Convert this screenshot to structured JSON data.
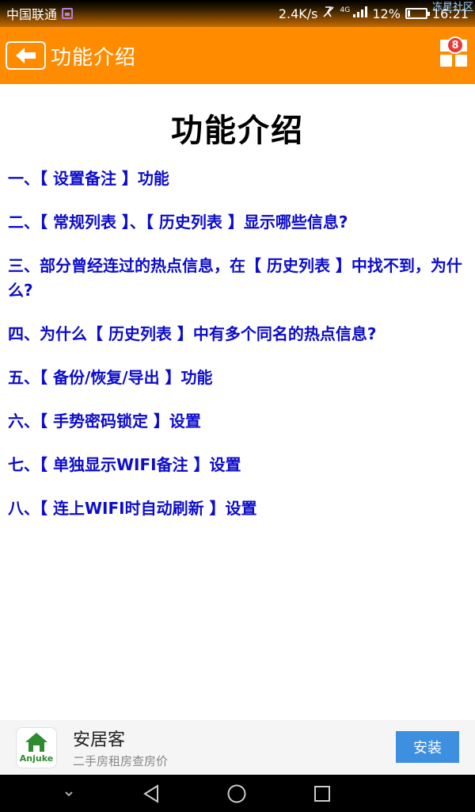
{
  "status_bar": {
    "carrier": "中国联通",
    "speed": "2.4K/s",
    "network": "4G",
    "battery_text": "12%",
    "battery_level": 0.12,
    "time": "16:21",
    "watermark": "冻星社区"
  },
  "app_bar": {
    "title": "功能介绍",
    "badge_count": "8",
    "color": "#ff8c00"
  },
  "page": {
    "heading": "功能介绍",
    "items": [
      "一、【 设置备注 】功能",
      "二、【 常规列表 】、【 历史列表 】显示哪些信息?",
      "三、部分曾经连过的热点信息，在【 历史列表 】中找不到，为什么?",
      "四、为什么【 历史列表 】中有多个同名的热点信息?",
      "五、【 备份/恢复/导出 】功能",
      "六、【 手势密码锁定 】设置",
      "七、【 单独显示WIFI备注 】设置",
      "八、【 连上WIFI时自动刷新 】设置"
    ],
    "link_color": "#0c0ccc"
  },
  "ad": {
    "logo_text": "Anjuke",
    "app_name": "安居客",
    "description": "二手房租房查房价",
    "install_label": "安装"
  },
  "icons": {
    "back": "arrow-left",
    "grid": "grid-menu",
    "nav_collapse": "chevron-down",
    "nav_back": "triangle-back",
    "nav_home": "circle-home",
    "nav_recent": "square-recent"
  }
}
